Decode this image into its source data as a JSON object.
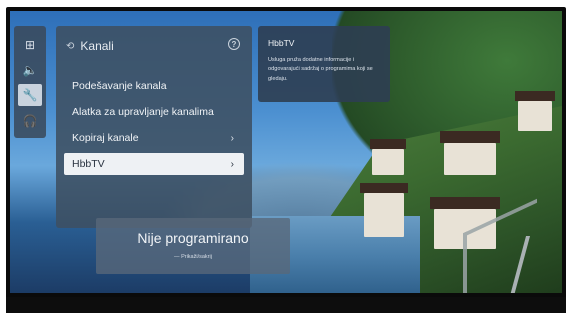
{
  "sidebar": {
    "icons": [
      {
        "name": "picture-icon",
        "glyph": "⊞",
        "selected": false
      },
      {
        "name": "sound-icon",
        "glyph": "🔈",
        "selected": false
      },
      {
        "name": "wrench-icon",
        "glyph": "🔧",
        "selected": true
      },
      {
        "name": "headphones-icon",
        "glyph": "🎧",
        "selected": false
      }
    ]
  },
  "menu": {
    "title": "Kanali",
    "items": [
      {
        "label": "Podešavanje kanala",
        "has_chevron": false,
        "selected": false
      },
      {
        "label": "Alatka za upravljanje kanalima",
        "has_chevron": false,
        "selected": false
      },
      {
        "label": "Kopiraj kanale",
        "has_chevron": true,
        "selected": false
      },
      {
        "label": "HbbTV",
        "has_chevron": true,
        "selected": true
      }
    ]
  },
  "info": {
    "title": "HbbTV",
    "description": "Usluga pruža dodatne informacije i odgovarajući sadržaj o programima koji se gledaju."
  },
  "status": {
    "title": "Nije programirano",
    "subtitle": "— Prikaži/sakrij"
  },
  "colors": {
    "panel": "#3e5062",
    "selected_bg": "#eef1f4",
    "text": "#f0f3f6"
  }
}
